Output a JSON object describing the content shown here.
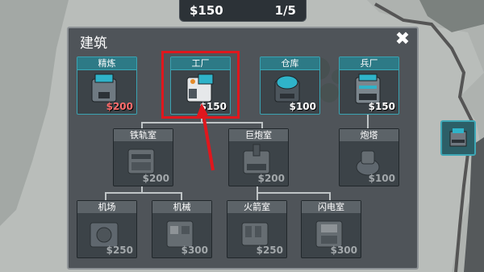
{
  "resource_bar": {
    "money": "$150",
    "count": "1/5"
  },
  "panel": {
    "title": "建筑",
    "close_icon": "close-x-icon"
  },
  "cards": {
    "refine": {
      "label": "精炼",
      "price": "$200",
      "price_state": "unaffordable",
      "icon": "refinery-icon"
    },
    "factory": {
      "label": "工厂",
      "price": "$150",
      "price_state": "affordable",
      "icon": "factory-icon"
    },
    "storage": {
      "label": "仓库",
      "price": "$100",
      "price_state": "affordable",
      "icon": "storage-icon"
    },
    "barracks": {
      "label": "兵厂",
      "price": "$150",
      "price_state": "affordable",
      "icon": "barracks-icon"
    },
    "rail": {
      "label": "铁轨室",
      "price": "$200",
      "price_state": "locked",
      "icon": "rail-room-icon"
    },
    "cannon": {
      "label": "巨炮室",
      "price": "$200",
      "price_state": "locked",
      "icon": "cannon-room-icon"
    },
    "turret": {
      "label": "炮塔",
      "price": "$100",
      "price_state": "locked",
      "icon": "turret-icon"
    },
    "airfield": {
      "label": "机场",
      "price": "$250",
      "price_state": "locked",
      "icon": "airfield-icon"
    },
    "mech": {
      "label": "机械",
      "price": "$300",
      "price_state": "locked",
      "icon": "mech-icon"
    },
    "rocket": {
      "label": "火箭室",
      "price": "$250",
      "price_state": "locked",
      "icon": "rocket-room-icon"
    },
    "flash": {
      "label": "闪电室",
      "price": "$300",
      "price_state": "locked",
      "icon": "flash-room-icon"
    }
  },
  "colors": {
    "accent": "#2d7a86",
    "unaffordable": "#ff6d6d",
    "highlight": "#e0171d"
  }
}
